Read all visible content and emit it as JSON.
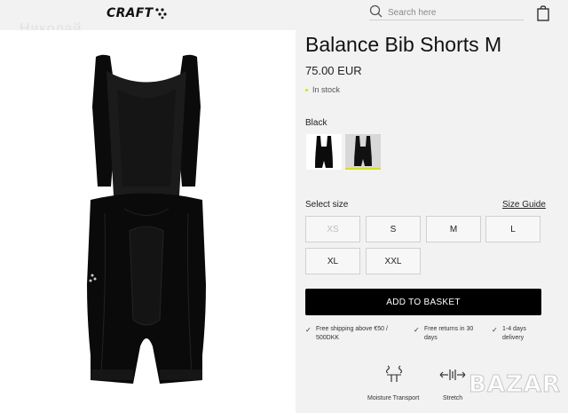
{
  "header": {
    "logo_text": "CRAFT",
    "search_placeholder": "Search here",
    "watermark_name": "Николай"
  },
  "product": {
    "title": "Balance Bib Shorts M",
    "price": "75.00 EUR",
    "stock_status": "In stock",
    "color_label": "Black",
    "image_description_icon": "bib-shorts-product-image"
  },
  "colors": {
    "accent": "#d6e400",
    "button_bg": "#000000",
    "panel_bg": "#ffffff",
    "page_bg": "#f2f2f2"
  },
  "sizes": {
    "label": "Select size",
    "guide_label": "Size Guide",
    "options": [
      {
        "label": "XS",
        "available": false
      },
      {
        "label": "S",
        "available": true
      },
      {
        "label": "M",
        "available": true
      },
      {
        "label": "L",
        "available": true
      },
      {
        "label": "XL",
        "available": true
      },
      {
        "label": "XXL",
        "available": true
      }
    ]
  },
  "actions": {
    "add_to_basket": "ADD TO BASKET"
  },
  "perks": [
    {
      "line1": "Free shipping above €50 /",
      "line2": "500DKK"
    },
    {
      "line1": "Free returns in 30",
      "line2": "days"
    },
    {
      "line1": "1-4 days",
      "line2": "delivery"
    }
  ],
  "features": [
    {
      "label": "Moisture Transport",
      "icon": "moisture-transport-icon"
    },
    {
      "label": "Stretch",
      "icon": "stretch-icon"
    }
  ],
  "watermark": "BAZAR"
}
